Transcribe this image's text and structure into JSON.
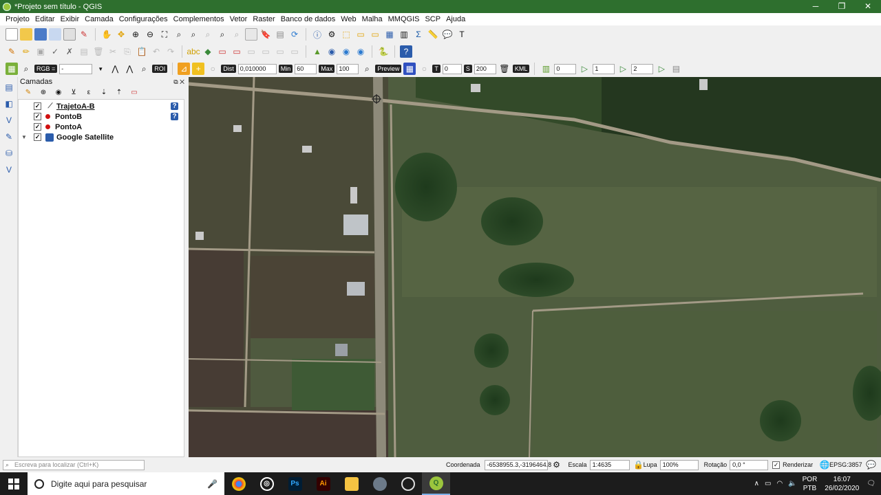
{
  "window": {
    "title": "*Projeto sem título - QGIS",
    "minimize": "─",
    "maximize": "❐",
    "close": "✕"
  },
  "menu": [
    "Projeto",
    "Editar",
    "Exibir",
    "Camada",
    "Configurações",
    "Complementos",
    "Vetor",
    "Raster",
    "Banco de dados",
    "Web",
    "Malha",
    "MMQGIS",
    "SCP",
    "Ajuda"
  ],
  "toolbar3": {
    "rgb_label": "RGB =",
    "rgb_value": "-",
    "roi_label": "ROI",
    "dist_label": "Dist",
    "dist_value": "0,010000",
    "min_label": "Min",
    "min_value": "60",
    "max_label": "Max",
    "max_value": "100",
    "preview_label": "Preview",
    "t_label": "T",
    "t_value": "0",
    "s_label": "S",
    "s_value": "200",
    "kml_label": "KML",
    "band1_value": "0",
    "band2_value": "1",
    "band3_value": "2"
  },
  "layers_panel": {
    "title": "Camadas",
    "layers": [
      {
        "name": "TrajetoA-B",
        "checked": true,
        "type": "line",
        "unknown_crs": true
      },
      {
        "name": "PontoB",
        "checked": true,
        "type": "point",
        "unknown_crs": true
      },
      {
        "name": "PontoA",
        "checked": true,
        "type": "point",
        "unknown_crs": false
      },
      {
        "name": "Google Satellite",
        "checked": true,
        "type": "raster",
        "unknown_crs": false
      }
    ]
  },
  "statusbar": {
    "locator_placeholder": "Escreva para localizar (Ctrl+K)",
    "coord_label": "Coordenada",
    "coord_value": "-6538955.3,-3196464.8",
    "scale_label": "Escala",
    "scale_value": "1:4635",
    "magnifier_label": "Lupa",
    "magnifier_value": "100%",
    "rotation_label": "Rotação",
    "rotation_value": "0,0 °",
    "render_label": "Renderizar",
    "crs_label": "EPSG:3857"
  },
  "taskbar": {
    "search_placeholder": "Digite aqui para pesquisar",
    "lang_top": "POR",
    "lang_bottom": "PTB",
    "time": "16:07",
    "date": "26/02/2020"
  },
  "colors": {
    "titlebar": "#2e6f2e",
    "field": "#4e5a3e",
    "road": "#a39a86",
    "point": "#d01010"
  }
}
